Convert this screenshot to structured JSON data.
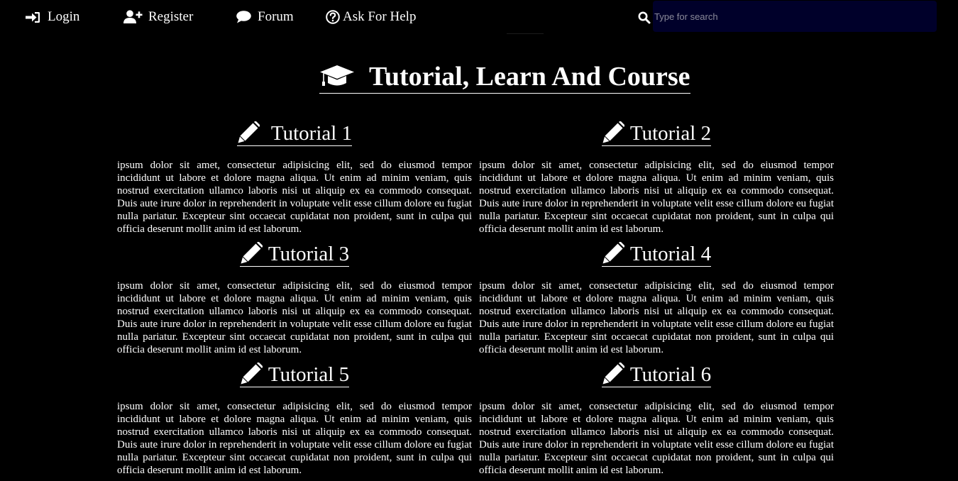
{
  "nav": {
    "login": {
      "label": "Login",
      "icon": "sign-in-icon"
    },
    "register": {
      "label": "Register",
      "icon": "user-plus-icon"
    },
    "forum": {
      "label": "Forum",
      "icon": "comment-icon"
    },
    "help": {
      "label": "Ask For Help",
      "icon": "question-circle-icon"
    }
  },
  "search": {
    "placeholder": "Type for search",
    "icon": "search-icon",
    "background": "#00002a"
  },
  "heading": {
    "title": "Tutorial, Learn And Course",
    "icon": "graduation-cap-icon"
  },
  "tutorials": [
    {
      "title": "Tutorial 1",
      "icon": "pencil-icon",
      "text": "ipsum dolor sit amet, consectetur adipisicing elit, sed do eiusmod tempor incididunt ut labore et dolore magna aliqua. Ut enim ad minim veniam, quis nostrud exercitation ullamco laboris nisi ut aliquip ex ea commodo consequat. Duis aute irure dolor in reprehenderit in voluptate velit esse cillum dolore eu fugiat nulla pariatur. Excepteur sint occaecat cupidatat non proident, sunt in culpa qui officia deserunt mollit anim id est laborum."
    },
    {
      "title": "Tutorial 2",
      "icon": "pencil-icon",
      "text": "ipsum dolor sit amet, consectetur adipisicing elit, sed do eiusmod tempor incididunt ut labore et dolore magna aliqua. Ut enim ad minim veniam, quis nostrud exercitation ullamco laboris nisi ut aliquip ex ea commodo consequat. Duis aute irure dolor in reprehenderit in voluptate velit esse cillum dolore eu fugiat nulla pariatur. Excepteur sint occaecat cupidatat non proident, sunt in culpa qui officia deserunt mollit anim id est laborum."
    },
    {
      "title": "Tutorial 3",
      "icon": "pencil-icon",
      "text": "ipsum dolor sit amet, consectetur adipisicing elit, sed do eiusmod tempor incididunt ut labore et dolore magna aliqua. Ut enim ad minim veniam, quis nostrud exercitation ullamco laboris nisi ut aliquip ex ea commodo consequat. Duis aute irure dolor in reprehenderit in voluptate velit esse cillum dolore eu fugiat nulla pariatur. Excepteur sint occaecat cupidatat non proident, sunt in culpa qui officia deserunt mollit anim id est laborum."
    },
    {
      "title": "Tutorial 4",
      "icon": "pencil-icon",
      "text": "ipsum dolor sit amet, consectetur adipisicing elit, sed do eiusmod tempor incididunt ut labore et dolore magna aliqua. Ut enim ad minim veniam, quis nostrud exercitation ullamco laboris nisi ut aliquip ex ea commodo consequat. Duis aute irure dolor in reprehenderit in voluptate velit esse cillum dolore eu fugiat nulla pariatur. Excepteur sint occaecat cupidatat non proident, sunt in culpa qui officia deserunt mollit anim id est laborum."
    },
    {
      "title": "Tutorial 5",
      "icon": "pencil-icon",
      "text": "ipsum dolor sit amet, consectetur adipisicing elit, sed do eiusmod tempor incididunt ut labore et dolore magna aliqua. Ut enim ad minim veniam, quis nostrud exercitation ullamco laboris nisi ut aliquip ex ea commodo consequat. Duis aute irure dolor in reprehenderit in voluptate velit esse cillum dolore eu fugiat nulla pariatur. Excepteur sint occaecat cupidatat non proident, sunt in culpa qui officia deserunt mollit anim id est laborum."
    },
    {
      "title": "Tutorial 6",
      "icon": "pencil-icon",
      "text": "ipsum dolor sit amet, consectetur adipisicing elit, sed do eiusmod tempor incididunt ut labore et dolore magna aliqua. Ut enim ad minim veniam, quis nostrud exercitation ullamco laboris nisi ut aliquip ex ea commodo consequat. Duis aute irure dolor in reprehenderit in voluptate velit esse cillum dolore eu fugiat nulla pariatur. Excepteur sint occaecat cupidatat non proident, sunt in culpa qui officia deserunt mollit anim id est laborum."
    }
  ],
  "colors": {
    "background": "#000000",
    "text": "#ffffff",
    "search_field": "#00002a"
  }
}
